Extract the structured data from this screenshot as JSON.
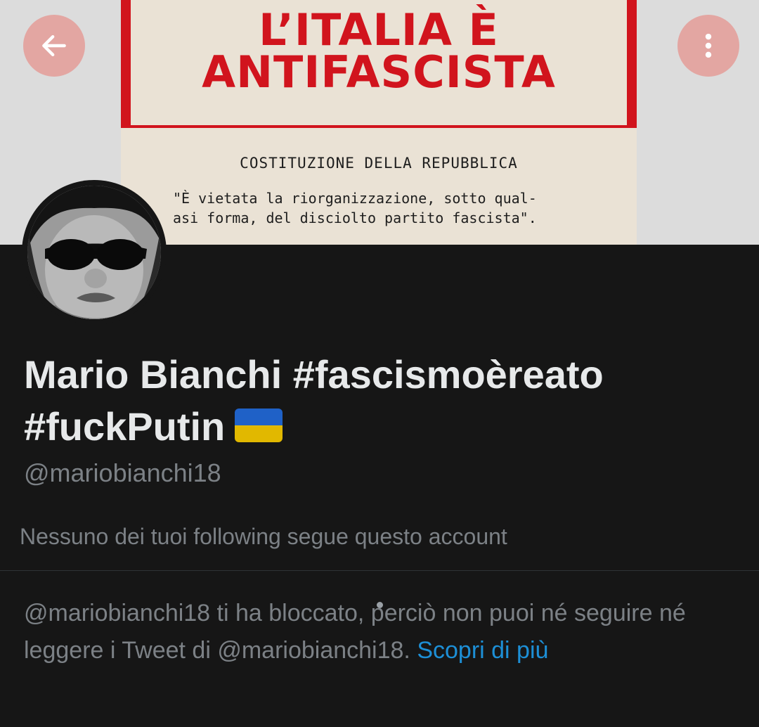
{
  "banner": {
    "poster_title_line1": "L’ITALIA È",
    "poster_title_line2": "ANTIFASCISTA",
    "poster_subtitle": "COSTITUZIONE DELLA REPUBBLICA",
    "poster_quote_line1": "\"È vietata la riorganizzazione, sotto qual-",
    "poster_quote_line2": "asi forma, del disciolto partito fascista\"."
  },
  "header": {
    "back_icon": "arrow-left-icon",
    "more_icon": "more-vertical-icon",
    "button_color": "#e3a6a2"
  },
  "profile": {
    "name": "Mario Bianchi #fascismoèreato #fuckPutin",
    "flag_icon": "ukraine-flag-icon",
    "handle": "@mariobianchi18",
    "followers_note": "Nessuno dei tuoi following segue questo account"
  },
  "blocked_notice": {
    "text": "@mariobianchi18 ti ha bloccato, perciò non puoi né seguire né leggere i Tweet di @mariobianchi18.",
    "link": "Scopri di più",
    "link_color": "#1d8fd6"
  }
}
